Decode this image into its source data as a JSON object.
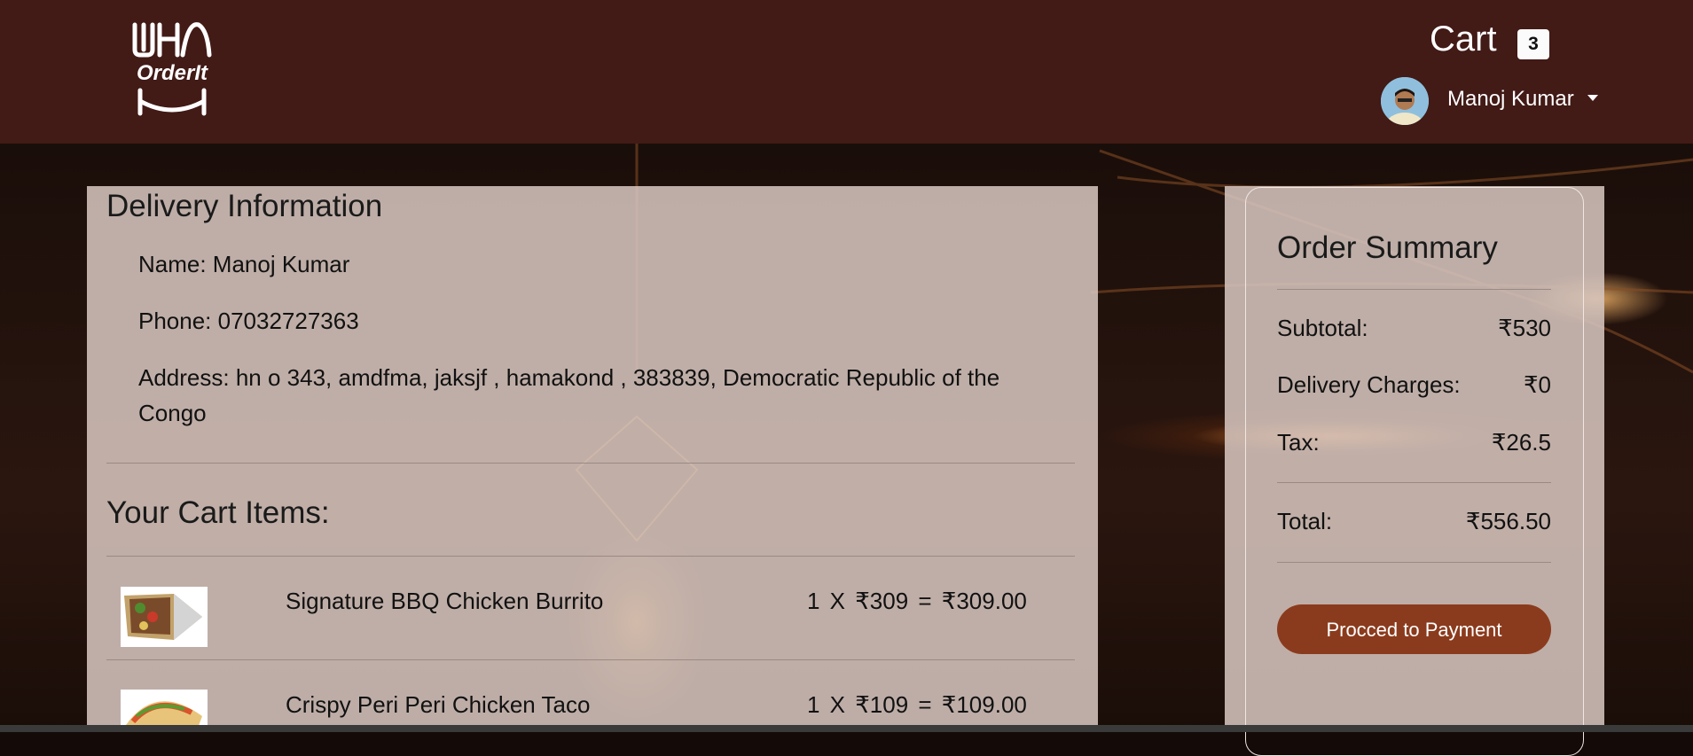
{
  "header": {
    "logo_text": "OrderIt",
    "cart_label": "Cart",
    "cart_count": "3",
    "user_name": "Manoj Kumar"
  },
  "delivery": {
    "title": "Delivery Information",
    "name": "Name:  Manoj Kumar",
    "phone": "Phone:  07032727363",
    "address_line1": "Address:  hn o 343, amdfma, jaksjf , hamakond , 383839, Democratic Republic of the",
    "address_line2": "Congo"
  },
  "cart": {
    "title": "Your Cart Items:",
    "items": [
      {
        "name": "Signature BBQ Chicken Burrito",
        "price_line": "1 X  ₹309 =  ₹309.00"
      },
      {
        "name": "Crispy Peri Peri Chicken Taco",
        "price_line": "1 X  ₹109 =  ₹109.00"
      }
    ]
  },
  "summary": {
    "title": "Order Summary",
    "subtotal_label": "Subtotal:",
    "subtotal_value": "₹530",
    "delivery_label": "Delivery Charges:",
    "delivery_value": "₹0",
    "tax_label": "Tax:",
    "tax_value": "₹26.5",
    "total_label": "Total:",
    "total_value": "₹556.50",
    "pay_button": "Procced to Payment"
  },
  "colors": {
    "header_bg": "#421a16",
    "panel_bg": "#d5c4bd",
    "button_bg": "#8b3b1d"
  }
}
